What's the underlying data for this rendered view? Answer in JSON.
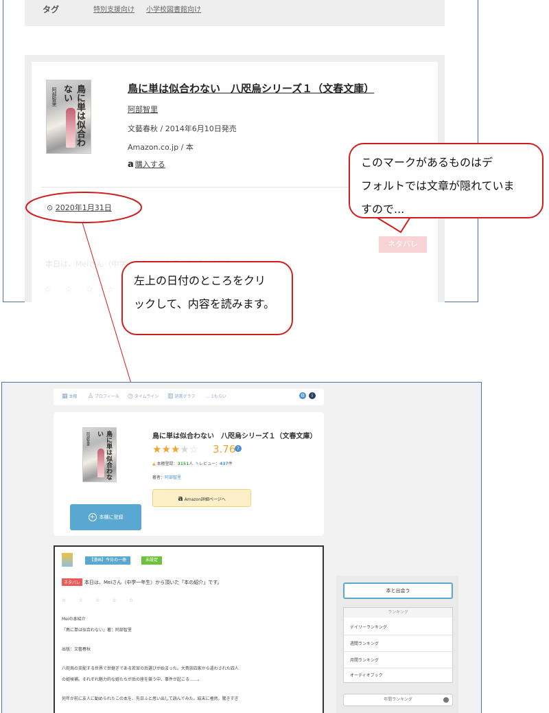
{
  "top": {
    "tags_label": "タグ",
    "tags": [
      "特別支援向け",
      "小学校図書館向け"
    ],
    "book_title": "鳥に単は似合わない　八咫烏シリーズ１（文春文庫）",
    "author": "阿部智里",
    "publisher_date": "文藝春秋 / 2014年6月10日発売",
    "store": "Amazon.co.jp / 本",
    "buy_label": "購入する",
    "buy_icon": "a",
    "date_icon": "⊙",
    "date": "2020年1月31日",
    "spoiler_label": "ネタバレ",
    "faded_text": "本日は、Meiさん（中学一年生）から頂いた「本の紹介」です。",
    "faded_stars": "☆ ☆ ☆ ☆ ☆",
    "cover_title": "鳥に単は似合わない",
    "cover_author": "阿部智里"
  },
  "callouts": {
    "spoiler_note": [
      "このマークがあるものはデ",
      "フォルトでは文章が隠れていま",
      "すので..."
    ],
    "date_note": [
      "左上の日付のところをクリ",
      "ックして、内容を読みます。"
    ]
  },
  "bottom": {
    "nav": [
      "本棚",
      "プロフィール",
      "タイムライン",
      "読書グラフ",
      "… 1もらい"
    ],
    "book_title": "鳥に単は似合わない　八咫烏シリーズ１（文春文庫）",
    "stars": "★★★",
    "half_star": "★☆",
    "rating": "3.76",
    "registered_label": "本棚登録：",
    "registered_count": "3151",
    "registered_unit": "人",
    "reviews_label": "レビュー：",
    "reviews_count": "437",
    "reviews_unit": "件",
    "author_label": "著者：",
    "author": "阿部智里",
    "amazon_label": "Amazon詳細ページへ",
    "register_label": "本棚に登録",
    "badge_blue": "【漫画】今日の一冊",
    "badge_green": "未設定",
    "spoiler_label": "ネタバレ",
    "review_first": "本日は、Meiさん（中学一年生）から頂いた「本の紹介」です。",
    "review_stars": "☆ ☆ ☆ ☆ ☆",
    "review_lines": [
      "Meiの本紹介",
      "『鳥に単は似合わない』著：阿部智里",
      "出版：文藝春秋",
      "八咫烏の支配する世界で世継ぎである若宮の后選びが始まった。大貴族四家から遣わされた四人",
      "の姫候補。それぞれ魅力的な姫たちが后の座を競う中、事件が起こる……。",
      "何年か前に友人に勧められたこの本を、先日ふと思い出して読んでみた。結末に唖然。驚きすぎ"
    ],
    "side_button": "本と出会う",
    "ranking_head": "ランキング",
    "ranking_items": [
      "デイリーランキング",
      "週間ランキング",
      "月間ランキング",
      "オーディオブック"
    ],
    "ranking_more": "年間ランキング"
  }
}
